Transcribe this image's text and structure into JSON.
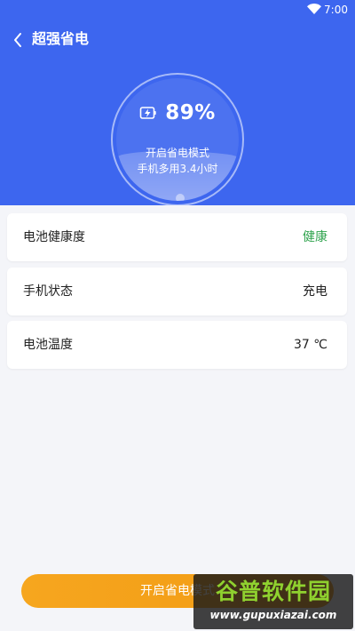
{
  "status_bar": {
    "time": "7:00",
    "wifi_icon": "wifi-icon"
  },
  "header": {
    "title": "超强省电",
    "back_icon": "chevron-left-icon"
  },
  "gauge": {
    "icon": "charging-battery-icon",
    "percent": "89%",
    "battery_level": 0.89,
    "mode_text": "开启省电模式",
    "extra_time_text": "手机多用3.4小时"
  },
  "info": [
    {
      "label": "电池健康度",
      "value": "健康",
      "value_color": "#2fa34d"
    },
    {
      "label": "手机状态",
      "value": "充电"
    },
    {
      "label": "电池温度",
      "value": "37 ℃"
    }
  ],
  "action": {
    "label": "开启省电模式"
  },
  "watermark": {
    "brand": "谷普软件园",
    "url": "www.gupuxiazai.com"
  },
  "colors": {
    "primary": "#3d66ef",
    "cta": "#f6a61f",
    "good": "#2fa34d",
    "background": "#f4f5f9"
  }
}
